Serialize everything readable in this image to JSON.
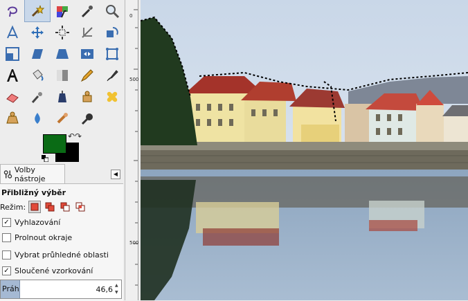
{
  "toolbox": {
    "tools": [
      {
        "name": "lasso-select-icon"
      },
      {
        "name": "fuzzy-select-icon",
        "active": true
      },
      {
        "name": "select-by-color-icon"
      },
      {
        "name": "color-picker-icon"
      },
      {
        "name": "zoom-icon"
      },
      {
        "name": "measure-icon"
      },
      {
        "name": "move-icon"
      },
      {
        "name": "align-icon"
      },
      {
        "name": "crop-icon"
      },
      {
        "name": "rotate-icon"
      },
      {
        "name": "scale-icon"
      },
      {
        "name": "shear-icon"
      },
      {
        "name": "perspective-icon"
      },
      {
        "name": "flip-icon"
      },
      {
        "name": "cage-transform-icon"
      },
      {
        "name": "text-icon"
      },
      {
        "name": "bucket-fill-icon"
      },
      {
        "name": "blend-icon"
      },
      {
        "name": "pencil-icon"
      },
      {
        "name": "paintbrush-icon"
      },
      {
        "name": "eraser-icon"
      },
      {
        "name": "airbrush-icon"
      },
      {
        "name": "ink-icon"
      },
      {
        "name": "clone-icon"
      },
      {
        "name": "heal-icon"
      },
      {
        "name": "perspective-clone-icon"
      },
      {
        "name": "blur-sharpen-icon"
      },
      {
        "name": "smudge-icon"
      },
      {
        "name": "dodge-burn-icon"
      }
    ]
  },
  "colors": {
    "foreground": "#0a6b15",
    "background": "#000000",
    "swap_glyph": "↶↷"
  },
  "dock": {
    "tab_label": "Volby nástroje",
    "menu_glyph": "◀"
  },
  "tool_options": {
    "title": "Přibližný výběr",
    "mode_label": "Režim:",
    "options": [
      {
        "label": "Vyhlazování",
        "checked": true
      },
      {
        "label": "Prolnout okraje",
        "checked": false
      },
      {
        "label": "Vybrat průhledné oblasti",
        "checked": false
      },
      {
        "label": "Sloučené vzorkování",
        "checked": true
      }
    ],
    "threshold_label": "Práh",
    "threshold_value": "46,6"
  },
  "ruler": {
    "labels": [
      "0",
      "500",
      "500"
    ]
  }
}
